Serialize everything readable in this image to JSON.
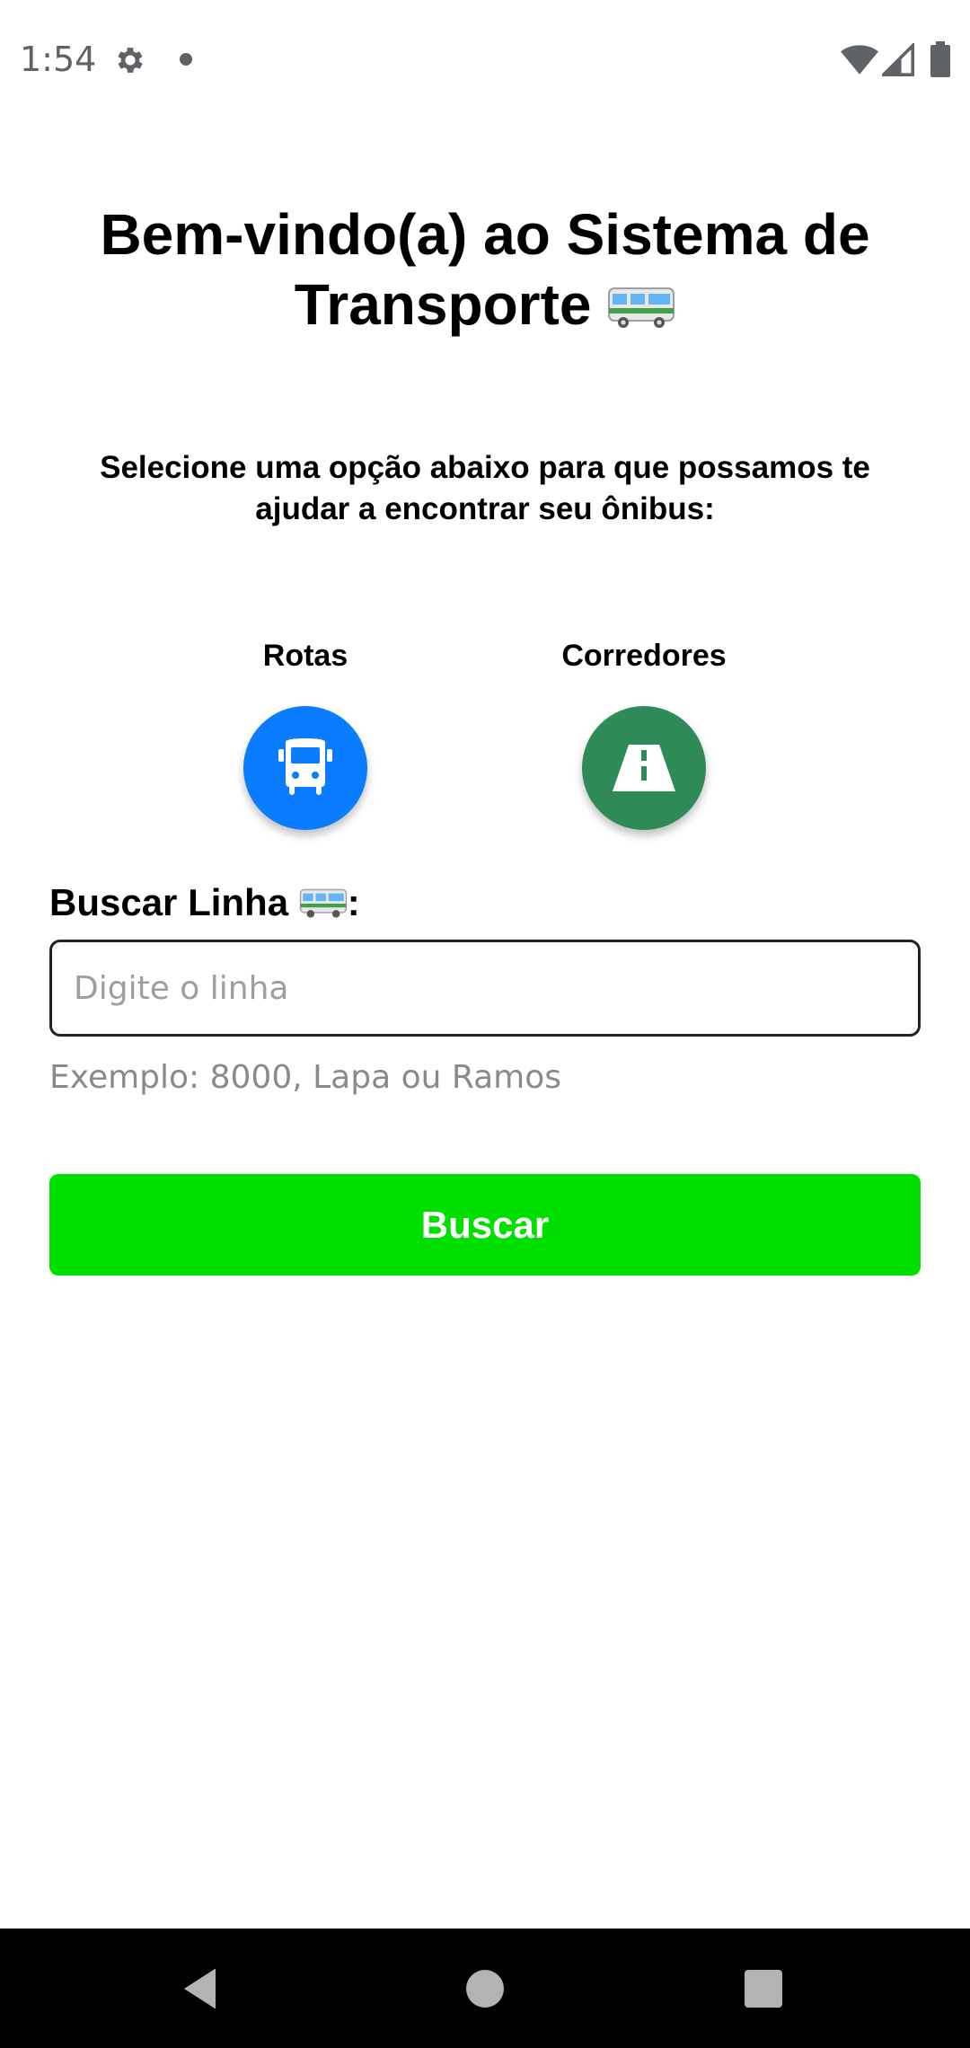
{
  "status_bar": {
    "time": "1:54",
    "icons": [
      "gear-icon",
      "notification-dot-icon",
      "wifi-icon",
      "signal-icon",
      "battery-icon"
    ]
  },
  "header": {
    "title_part1": "Bem-vindo(a) ao Sistema de",
    "title_part2": "Transporte",
    "title_icon": "bus-emoji-icon"
  },
  "subtitle": "Selecione uma opção abaixo para que possamos te ajudar a encontrar seu ônibus:",
  "options": [
    {
      "label": "Rotas",
      "icon": "bus-icon",
      "color": "#0a7cff"
    },
    {
      "label": "Corredores",
      "icon": "road-icon",
      "color": "#2e8b57"
    }
  ],
  "search": {
    "label": "Buscar Linha",
    "label_icon": "bus-emoji-icon",
    "label_suffix": ":",
    "placeholder": "Digite o linha",
    "value": "",
    "helper": "Exemplo: 8000, Lapa ou Ramos",
    "button_label": "Buscar",
    "button_color": "#00e000"
  },
  "nav_bar": {
    "icons": [
      "back-icon",
      "home-icon",
      "recents-icon"
    ]
  }
}
